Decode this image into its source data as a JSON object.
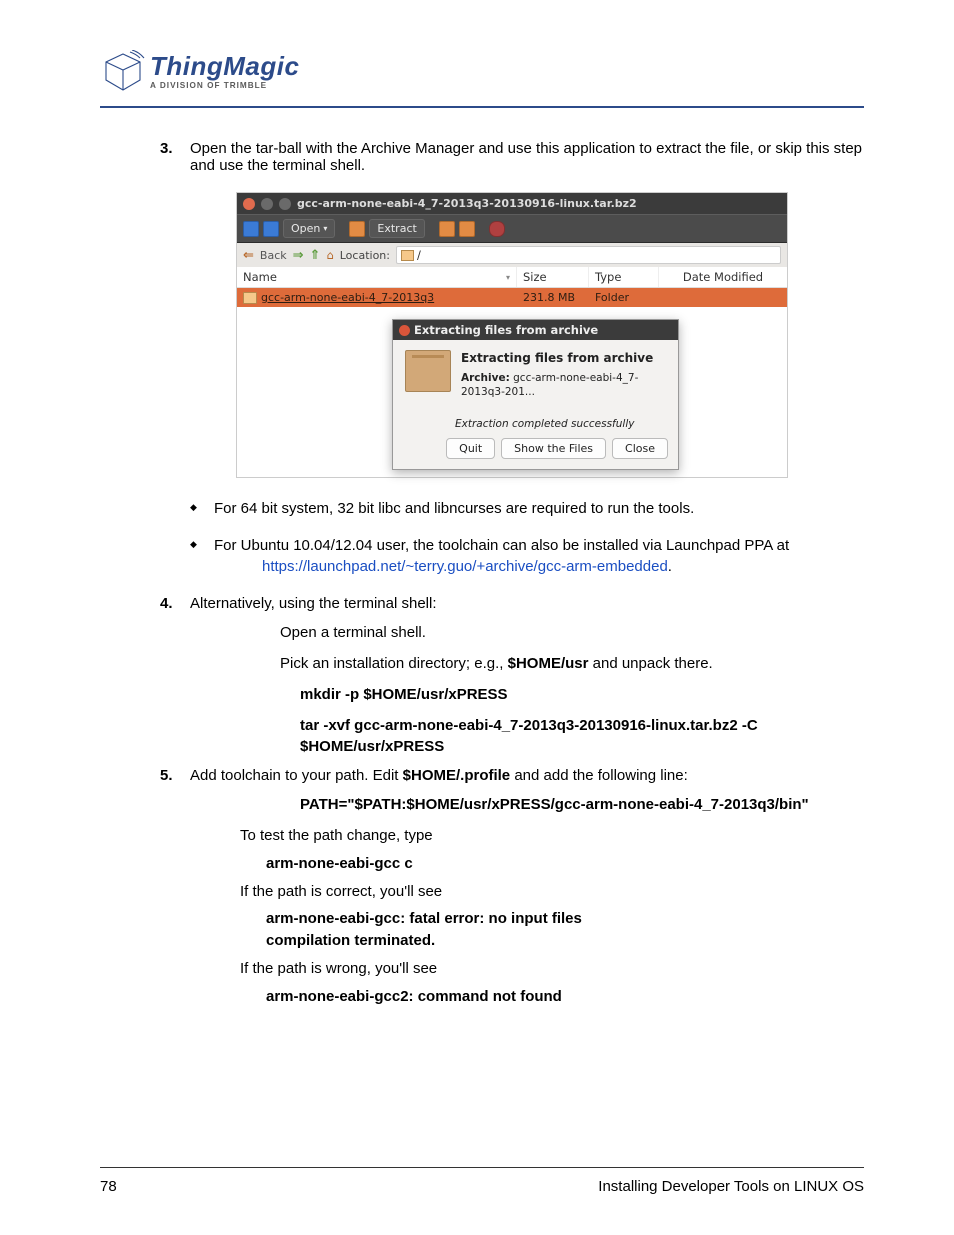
{
  "logo": {
    "main": "ThingMagic",
    "sub": "A DIVISION OF TRIMBLE"
  },
  "step3": {
    "num": "3.",
    "text": "Open the tar-ball with the Archive Manager and use this application to extract the file, or skip this step and use the terminal shell."
  },
  "archive": {
    "title": "gcc-arm-none-eabi-4_7-2013q3-20130916-linux.tar.bz2",
    "open": "Open",
    "extract": "Extract",
    "back": "Back",
    "location_label": "Location:",
    "location_value": "/",
    "cols": {
      "name": "Name",
      "size": "Size",
      "type": "Type",
      "date": "Date Modified"
    },
    "row": {
      "name": "gcc-arm-none-eabi-4_7-2013q3",
      "size": "231.8 MB",
      "type": "Folder",
      "date": ""
    }
  },
  "dialog": {
    "winTitle": "Extracting files from archive",
    "heading": "Extracting files from archive",
    "archiveLabel": "Archive:",
    "archiveValue": "gcc-arm-none-eabi-4_7-2013q3-201...",
    "status": "Extraction completed successfully",
    "quit": "Quit",
    "show": "Show the Files",
    "close": "Close"
  },
  "bullet1": "For 64 bit system, 32 bit libc and libncurses are required to run the tools.",
  "bullet2_pre": "For Ubuntu 10.04/12.04 user, the toolchain can also be installed via Launchpad PPA at ",
  "bullet2_link": "https://launchpad.net/~terry.guo/+archive/gcc-arm-embedded",
  "bullet2_post": ".",
  "step4": {
    "num": "4.",
    "text": "Alternatively, using the terminal shell:",
    "line1": "Open a terminal shell.",
    "line2_pre": "Pick an installation directory; e.g., ",
    "line2_bold": "$HOME/usr",
    "line2_post": " and unpack there.",
    "cmd1": "mkdir -p $HOME/usr/xPRESS",
    "cmd2": "tar -xvf gcc-arm-none-eabi-4_7-2013q3-20130916-linux.tar.bz2 -C $HOME/usr/xPRESS"
  },
  "step5": {
    "num": "5.",
    "text_pre": "Add toolchain to your path.  Edit ",
    "text_bold": "$HOME/.profile",
    "text_post": " and add the following line:",
    "pathline": "PATH=\"$PATH:$HOME/usr/xPRESS/gcc-arm-none-eabi-4_7-2013q3/bin\"",
    "testIntro": "To test the path change, type",
    "testCmd": "arm-none-eabi-gcc c",
    "okIntro": "If the path is correct, you'll see",
    "okLine1": "arm-none-eabi-gcc: fatal error: no input files",
    "okLine2": "compilation terminated.",
    "badIntro": "If the path is wrong, you'll see",
    "badLine": "arm-none-eabi-gcc2: command not found"
  },
  "footer": {
    "page": "78",
    "section": "Installing Developer Tools on LINUX OS"
  }
}
